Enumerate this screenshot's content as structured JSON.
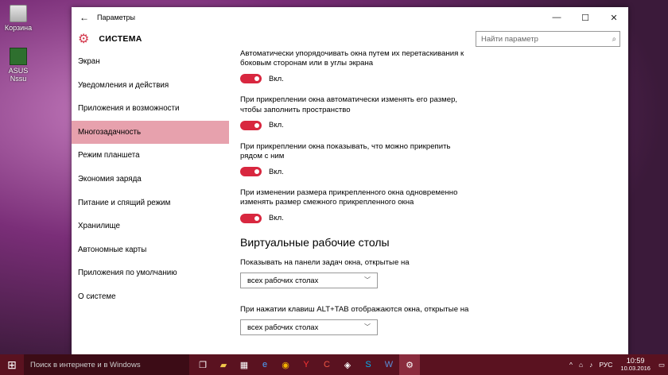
{
  "desktop": {
    "icons": [
      {
        "label": "Корзина"
      },
      {
        "label": "ASUS Nssu"
      }
    ]
  },
  "window": {
    "title": "Параметры",
    "controls": {
      "minimize": "—",
      "maximize": "☐",
      "close": "✕"
    },
    "section": "СИСТЕМА",
    "search_placeholder": "Найти параметр"
  },
  "sidebar": {
    "items": [
      {
        "label": "Экран"
      },
      {
        "label": "Уведомления и действия"
      },
      {
        "label": "Приложения и возможности"
      },
      {
        "label": "Многозадачность",
        "active": true
      },
      {
        "label": "Режим планшета"
      },
      {
        "label": "Экономия заряда"
      },
      {
        "label": "Питание и спящий режим"
      },
      {
        "label": "Хранилище"
      },
      {
        "label": "Автономные карты"
      },
      {
        "label": "Приложения по умолчанию"
      },
      {
        "label": "О системе"
      }
    ]
  },
  "content": {
    "settings": [
      {
        "text": "Автоматически упорядочивать окна путем их перетаскивания к боковым сторонам или в углы экрана",
        "state": "Вкл."
      },
      {
        "text": "При прикреплении окна автоматически изменять его размер, чтобы заполнить пространство",
        "state": "Вкл."
      },
      {
        "text": "При прикреплении окна показывать, что можно прикрепить рядом с ним",
        "state": "Вкл."
      },
      {
        "text": "При изменении размера прикрепленного окна одновременно изменять размер смежного прикрепленного окна",
        "state": "Вкл."
      }
    ],
    "virtual_desktops": {
      "heading": "Виртуальные рабочие столы",
      "taskbar_label": "Показывать на панели задач окна, открытые на",
      "taskbar_value": "всех рабочих столах",
      "alttab_label": "При нажатии клавиш ALT+TAB отображаются окна, открытые на",
      "alttab_value": "всех рабочих столах"
    }
  },
  "taskbar": {
    "search_placeholder": "Поиск в интернете и в Windows",
    "lang": "РУС",
    "time": "10:59",
    "date": "10.03.2016"
  },
  "colors": {
    "accent": "#d8273f",
    "active_nav": "#e7a1ad",
    "taskbar": "#5a1220"
  }
}
